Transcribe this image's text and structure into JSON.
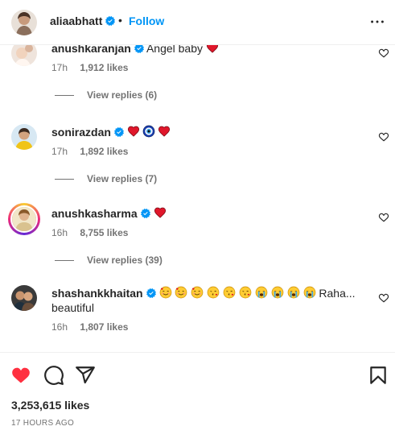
{
  "header": {
    "username": "aliaabhatt",
    "dot": "•",
    "follow_label": "Follow",
    "more_icon": "more-horizontal-icon"
  },
  "comments": [
    {
      "username": "anushkaranjan",
      "verified": true,
      "text": "Angel baby",
      "emojis": [
        "red-heart"
      ],
      "time": "17h",
      "likes": "1,912 likes",
      "replies": "View replies (6)"
    },
    {
      "username": "sonirazdan",
      "verified": true,
      "text": "",
      "emojis": [
        "red-heart",
        "nazar-amulet",
        "red-heart"
      ],
      "time": "17h",
      "likes": "1,892 likes",
      "replies": "View replies (7)"
    },
    {
      "username": "anushkasharma",
      "verified": true,
      "text": "",
      "emojis": [
        "red-heart"
      ],
      "time": "16h",
      "likes": "8,755 likes",
      "replies": "View replies (39)"
    },
    {
      "username": "shashankkhaitan",
      "verified": true,
      "text": "Raha... beautiful",
      "emojis": [
        "smiling-face-with-hearts",
        "smiling-face-with-hearts",
        "smiling-face-with-hearts",
        "face-blowing-kiss",
        "face-blowing-kiss",
        "face-blowing-kiss",
        "loudly-crying-face",
        "loudly-crying-face",
        "loudly-crying-face",
        "loudly-crying-face"
      ],
      "time": "16h",
      "likes": "1,807 likes"
    }
  ],
  "actions": {
    "like_icon": "heart-filled-icon",
    "comment_icon": "comment-icon",
    "share_icon": "share-icon",
    "save_icon": "bookmark-icon",
    "likes_count": "3,253,615 likes",
    "time_ago": "17 HOURS AGO"
  },
  "colors": {
    "accent": "#0095f6",
    "verified": "#0095f6",
    "like_red": "#ff3040",
    "text": "#262626",
    "secondary": "#737373"
  }
}
